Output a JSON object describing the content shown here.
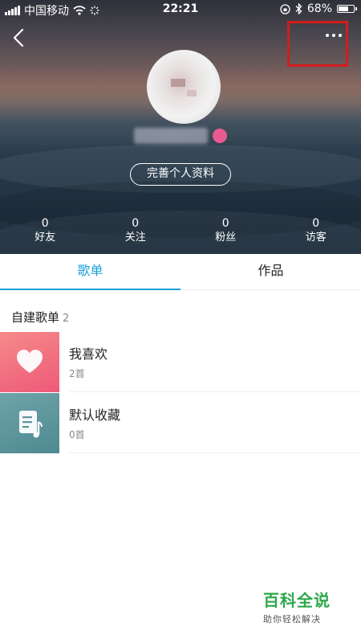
{
  "status_bar": {
    "carrier": "中国移动",
    "time": "22:21",
    "battery": "68%"
  },
  "profile": {
    "edit_button": "完善个人资料"
  },
  "stats": [
    {
      "count": "0",
      "label": "好友"
    },
    {
      "count": "0",
      "label": "关注"
    },
    {
      "count": "0",
      "label": "粉丝"
    },
    {
      "count": "0",
      "label": "访客"
    }
  ],
  "tabs": [
    {
      "label": "歌单",
      "active": true
    },
    {
      "label": "作品",
      "active": false
    }
  ],
  "section": {
    "title": "自建歌单",
    "count": "2"
  },
  "playlists": [
    {
      "name": "我喜欢",
      "count": "2首",
      "icon": "heart-icon",
      "color": "#f0607a"
    },
    {
      "name": "默认收藏",
      "count": "0首",
      "icon": "music-note-icon",
      "color": "#5e969c"
    }
  ],
  "watermark": {
    "title": "百科全说",
    "subtitle": "助你轻松解决"
  },
  "colors": {
    "accent": "#1aa0d8",
    "highlight_box": "#d41c1c"
  }
}
